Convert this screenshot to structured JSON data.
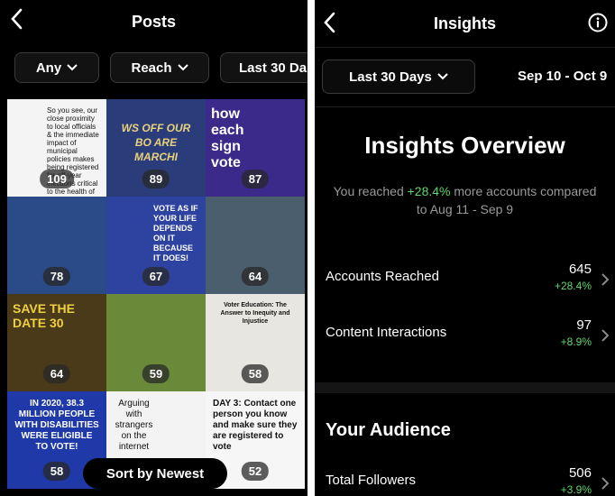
{
  "left": {
    "title": "Posts",
    "filters": [
      {
        "label": "Any"
      },
      {
        "label": "Reach"
      },
      {
        "label": "Last 30 Da"
      }
    ],
    "tiles": [
      {
        "count": "109",
        "caption": "So you see, our close proximity to local officials & the immediate impact of municipal policies makes being registered for off-year elections critical to the health of democracy."
      },
      {
        "count": "89",
        "caption": "WS OFF OUR BO  ARE MARCHI"
      },
      {
        "count": "87",
        "caption": "how each sign vote"
      },
      {
        "count": "78",
        "caption": ""
      },
      {
        "count": "67",
        "caption": "VOTE AS IF YOUR LIFE DEPENDS ON IT BECAUSE IT DOES!"
      },
      {
        "count": "64",
        "caption": ""
      },
      {
        "count": "64",
        "caption": "SAVE THE DATE 30"
      },
      {
        "count": "59",
        "caption": ""
      },
      {
        "count": "58",
        "caption": "Voter Education: The Answer to Inequity and Injustice"
      },
      {
        "count": "58",
        "caption": "IN 2020, 38.3 MILLION PEOPLE WITH DISABILITIES WERE ELIGIBLE TO VOTE!"
      },
      {
        "count": "",
        "caption": "Arguing with strangers on the internet"
      },
      {
        "count": "52",
        "caption": "DAY 3: Contact one person you know and make sure they are registered to vote"
      }
    ],
    "sort_label": "Sort by Newest"
  },
  "right": {
    "title": "Insights",
    "date_pill": "Last 30 Days",
    "date_range": "Sep 10 - Oct 9",
    "overview_title": "Insights Overview",
    "reach_pre": "You reached ",
    "reach_pct": "+28.4%",
    "reach_post": " more accounts compared to Aug 11 - Sep 9",
    "metrics": [
      {
        "label": "Accounts Reached",
        "value": "645",
        "change": "+28.4%"
      },
      {
        "label": "Content Interactions",
        "value": "97",
        "change": "+8.9%"
      }
    ],
    "audience_title": "Your Audience",
    "followers": {
      "label": "Total Followers",
      "value": "506",
      "change": "+3.9%"
    }
  },
  "colors": {
    "background": "#000000",
    "positive": "#5ed66d",
    "muted": "#9a9a9a"
  }
}
